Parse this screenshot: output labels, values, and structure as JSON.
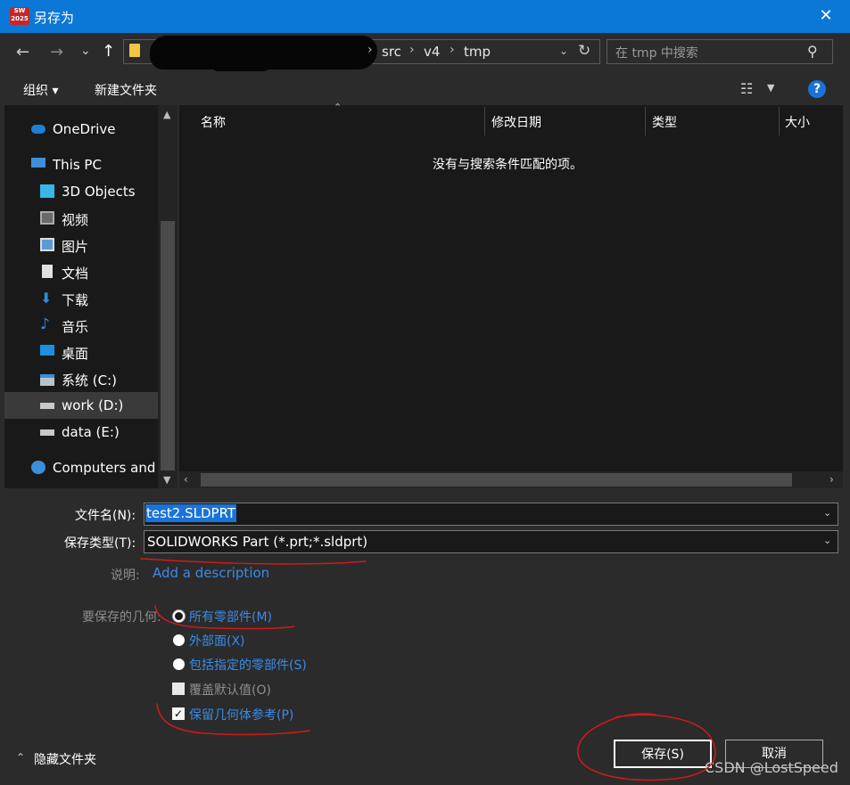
{
  "window": {
    "title": "另存为",
    "app_icon_text": "SW 2025"
  },
  "nav": {
    "back": "←",
    "forward": "→",
    "recent": "⌄",
    "up": "↑",
    "breadcrumbs": [
      "src",
      "v4",
      "tmp"
    ],
    "search_placeholder": "在 tmp 中搜索"
  },
  "toolbar": {
    "organize": "组织 ▾",
    "new_folder": "新建文件夹",
    "help": "?"
  },
  "sidebar": {
    "items": [
      {
        "label": "OneDrive"
      },
      {
        "label": "This PC"
      },
      {
        "label": "3D Objects"
      },
      {
        "label": "视频"
      },
      {
        "label": "图片"
      },
      {
        "label": "文档"
      },
      {
        "label": "下载"
      },
      {
        "label": "音乐"
      },
      {
        "label": "桌面"
      },
      {
        "label": "系统 (C:)"
      },
      {
        "label": "work (D:)"
      },
      {
        "label": "data (E:)"
      },
      {
        "label": "Computers and I"
      }
    ]
  },
  "filelist": {
    "columns": [
      "名称",
      "修改日期",
      "类型",
      "大小"
    ],
    "empty_message": "没有与搜索条件匹配的项。"
  },
  "form": {
    "filename_label": "文件名(N):",
    "filename_value": "test2.SLDPRT",
    "filetype_label": "保存类型(T):",
    "filetype_value": "SOLIDWORKS Part (*.prt;*.sldprt)",
    "description_label": "说明:",
    "description_link": "Add a description",
    "geometry_label": "要保存的几何:",
    "options": {
      "all_components": "所有零部件(M)",
      "exterior_faces": "外部面(X)",
      "specified_components": "包括指定的零部件(S)",
      "override_defaults": "覆盖默认值(O)",
      "preserve_geometry_refs": "保留几何体参考(P)"
    }
  },
  "footer": {
    "hide_folders": "隐藏文件夹",
    "save": "保存(S)",
    "cancel": "取消",
    "watermark": "CSDN @LostSpeed"
  }
}
